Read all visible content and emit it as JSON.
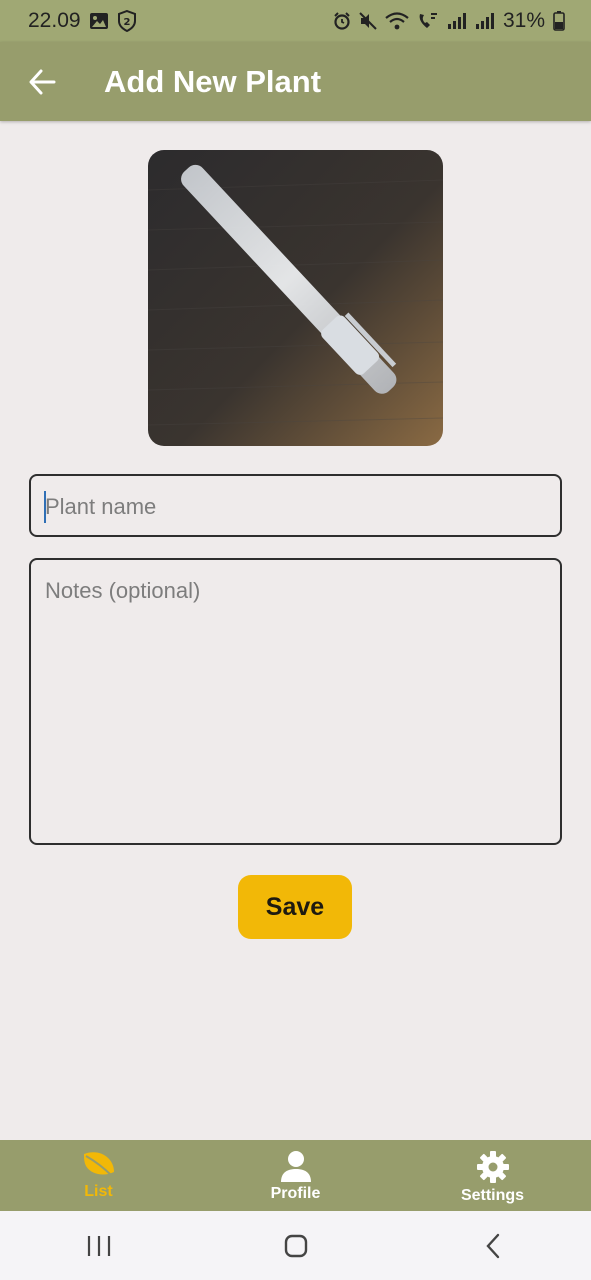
{
  "status_bar": {
    "time": "22.09",
    "notification_count": "2",
    "battery": "31%"
  },
  "app_bar": {
    "title": "Add New Plant",
    "back_icon": "arrow-back-icon"
  },
  "photo": {
    "description_icon": "plant-photo"
  },
  "form": {
    "name_placeholder": "Plant name",
    "name_value": "",
    "notes_placeholder": "Notes (optional)",
    "notes_value": "",
    "save_label": "Save"
  },
  "bottom_nav": {
    "items": [
      {
        "label": "List",
        "icon": "leaf-icon",
        "active": true
      },
      {
        "label": "Profile",
        "icon": "person-icon",
        "active": false
      },
      {
        "label": "Settings",
        "icon": "gear-icon",
        "active": false
      }
    ]
  },
  "colors": {
    "app_bar": "#979d6c",
    "accent": "#f2b807",
    "background": "#efebeb"
  }
}
